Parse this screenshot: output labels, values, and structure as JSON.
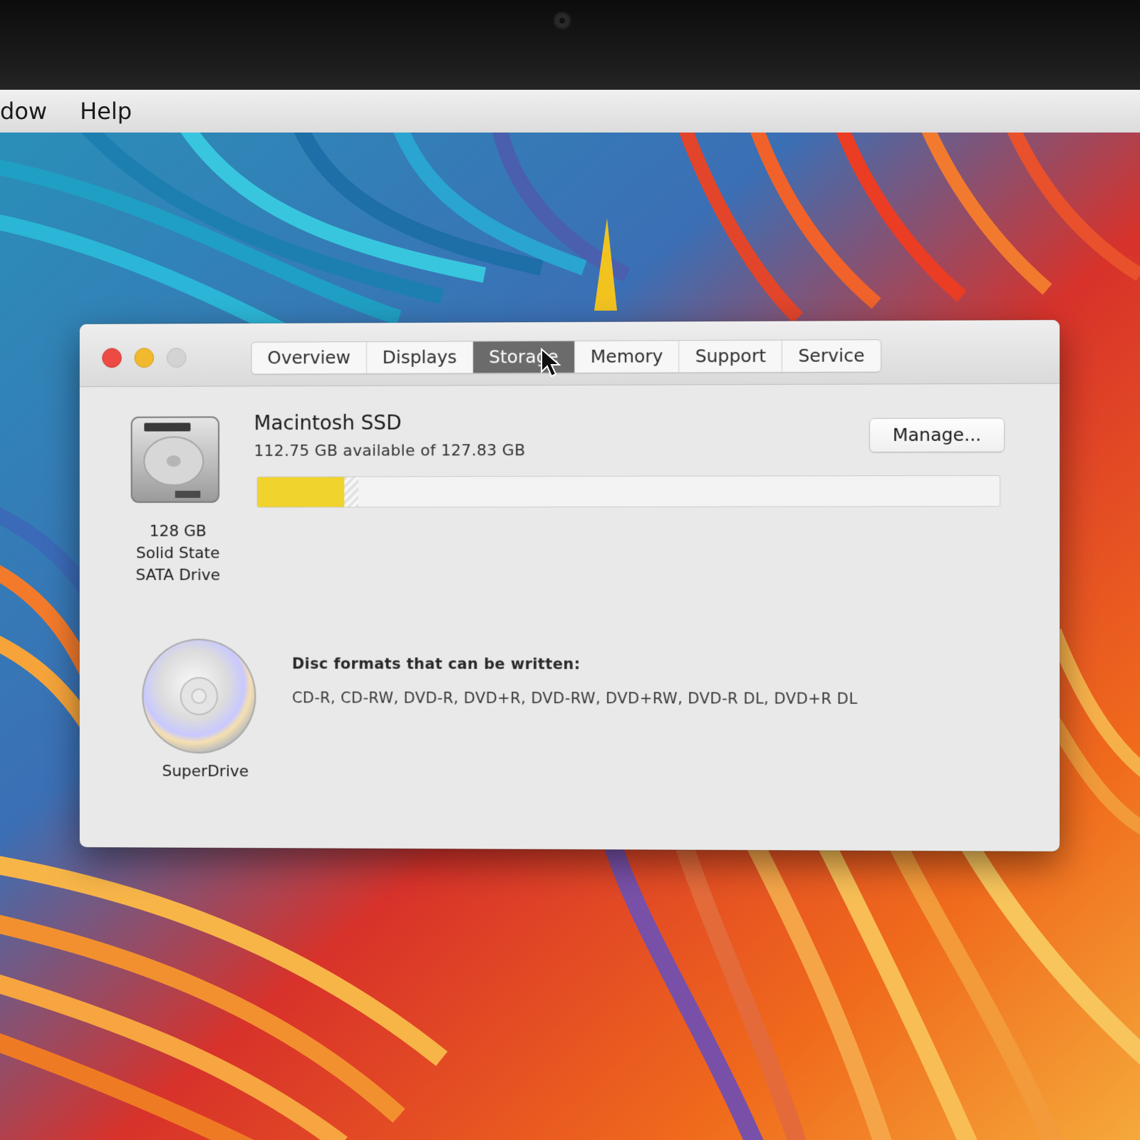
{
  "menubar": {
    "items": [
      "dow",
      "Help"
    ]
  },
  "window": {
    "tabs": [
      {
        "label": "Overview",
        "active": false
      },
      {
        "label": "Displays",
        "active": false
      },
      {
        "label": "Storage",
        "active": true
      },
      {
        "label": "Memory",
        "active": false
      },
      {
        "label": "Support",
        "active": false
      },
      {
        "label": "Service",
        "active": false
      }
    ],
    "storage": {
      "drive": {
        "caption_line1": "128 GB",
        "caption_line2": "Solid State",
        "caption_line3": "SATA Drive",
        "name": "Macintosh SSD",
        "availability": "112.75 GB available of 127.83 GB",
        "used_fraction": 0.118,
        "manage_label": "Manage..."
      },
      "optical": {
        "caption": "SuperDrive",
        "formats_title": "Disc formats that can be written:",
        "formats_list": "CD-R, CD-RW, DVD-R, DVD+R, DVD-RW, DVD+RW, DVD-R DL, DVD+R DL"
      }
    }
  },
  "colors": {
    "usage_fill": "#f0d32c",
    "close": "#ec4a43",
    "minimize": "#f1b92d",
    "zoom_disabled": "#d3d3d3",
    "active_tab": "#6b6b6b"
  },
  "icons": [
    "hard-drive-icon",
    "optical-disc-icon",
    "pointer-cursor-icon"
  ]
}
